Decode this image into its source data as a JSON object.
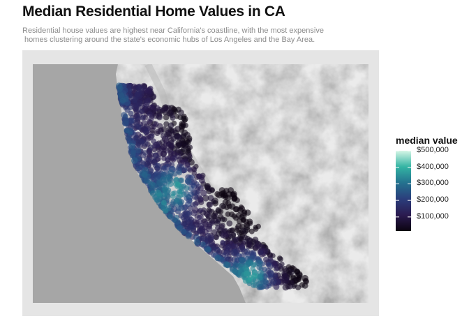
{
  "title": "Median Residential Home Values in CA",
  "subtitle": "Residential house values are highest near California's coastline, with the most expensive\n homes clustering around the state's economic hubs of Los Angeles and the Bay Area.",
  "colors": {
    "ocean": "#a6a6a6",
    "land": "#d2d2d2",
    "panel": "#e5e5e5",
    "low": "#0b0410",
    "high": "#d6f6e6"
  },
  "chart_data": {
    "type": "scatter",
    "title": "Median Residential Home Values in CA",
    "legend": {
      "title": "median value",
      "position": "right",
      "min": 15000,
      "max": 500000,
      "breaks": [
        500000,
        400000,
        300000,
        200000,
        100000
      ],
      "labels": [
        "$500,000",
        "$400,000",
        "$300,000",
        "$200,000",
        "$100,000"
      ]
    },
    "color_scale": [
      "#0b0410",
      "#2b1b50",
      "#2b3e7c",
      "#24728f",
      "#33b4a3",
      "#d6f6e6"
    ],
    "background": "terrain basemap",
    "grid": false
  }
}
